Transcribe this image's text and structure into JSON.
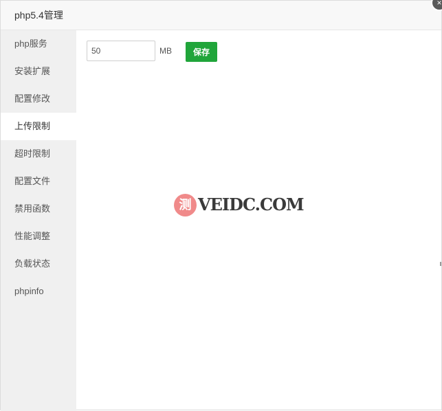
{
  "window": {
    "title": "php5.4管理",
    "close_glyph": "×"
  },
  "sidebar": {
    "items": [
      {
        "label": "php服务",
        "active": false
      },
      {
        "label": "安装扩展",
        "active": false
      },
      {
        "label": "配置修改",
        "active": false
      },
      {
        "label": "上传限制",
        "active": true
      },
      {
        "label": "超时限制",
        "active": false
      },
      {
        "label": "配置文件",
        "active": false
      },
      {
        "label": "禁用函数",
        "active": false
      },
      {
        "label": "性能调整",
        "active": false
      },
      {
        "label": "负载状态",
        "active": false
      },
      {
        "label": "phpinfo",
        "active": false
      }
    ]
  },
  "upload_limit": {
    "value": "50",
    "unit": "MB",
    "save_label": "保存"
  },
  "watermark": {
    "badge": "测",
    "text": "VEIDC.COM"
  },
  "colors": {
    "accent": "#20a53a",
    "sidebar_bg": "#f0f0f0",
    "titlebar_bg": "#f8f8f8",
    "watermark_badge": "#f08a8a"
  }
}
